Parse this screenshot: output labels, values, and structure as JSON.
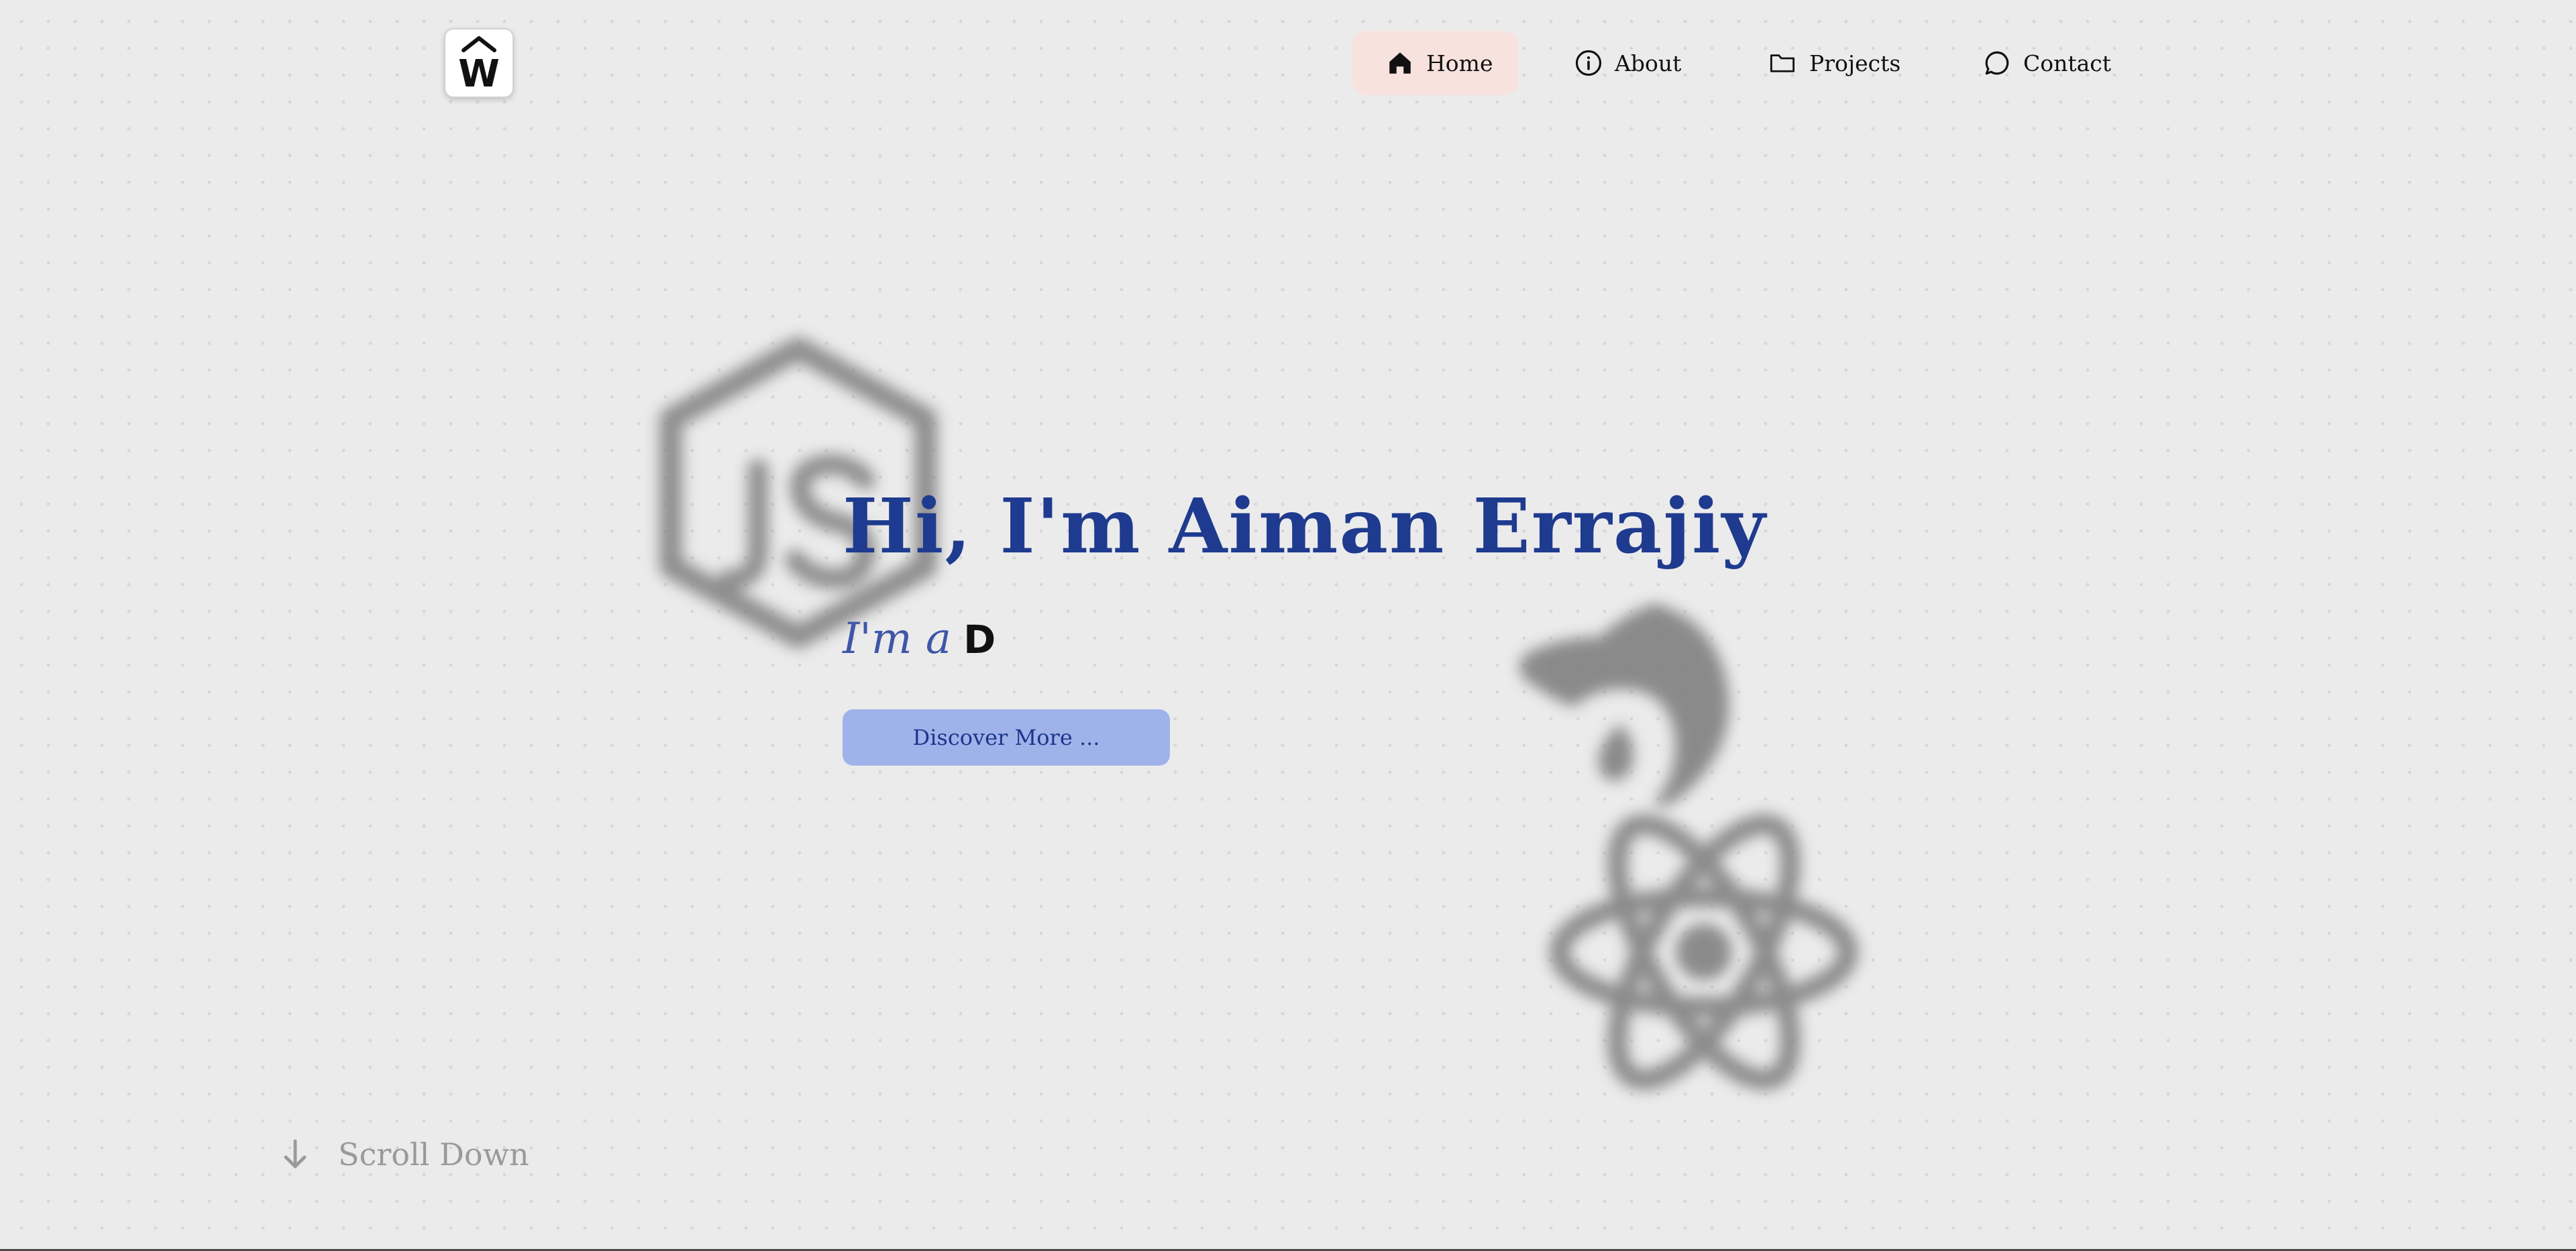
{
  "logo": {
    "letter": "W",
    "icon": "house-w-logo-icon"
  },
  "nav": {
    "items": [
      {
        "label": "Home",
        "icon": "home-icon",
        "active": true
      },
      {
        "label": "About",
        "icon": "info-icon",
        "active": false
      },
      {
        "label": "Projects",
        "icon": "folder-icon",
        "active": false
      },
      {
        "label": "Contact",
        "icon": "chat-bubble-icon",
        "active": false
      }
    ]
  },
  "hero": {
    "title": "Hi, I'm Aiman Errajiy",
    "subtitle_prefix": "I'm a",
    "typed_text": "D",
    "button_label": "Discover More ..."
  },
  "background_logos": [
    "nodejs-icon",
    "nestjs-icon",
    "react-icon"
  ],
  "scroll": {
    "label": "Scroll Down",
    "icon": "arrow-down-icon"
  },
  "colors": {
    "title": "#1f3b8f",
    "subtitle": "#3f56a8",
    "button_bg": "#9fb3ea",
    "nav_active_bg": "#f7e2de",
    "page_bg": "#ebebec"
  }
}
